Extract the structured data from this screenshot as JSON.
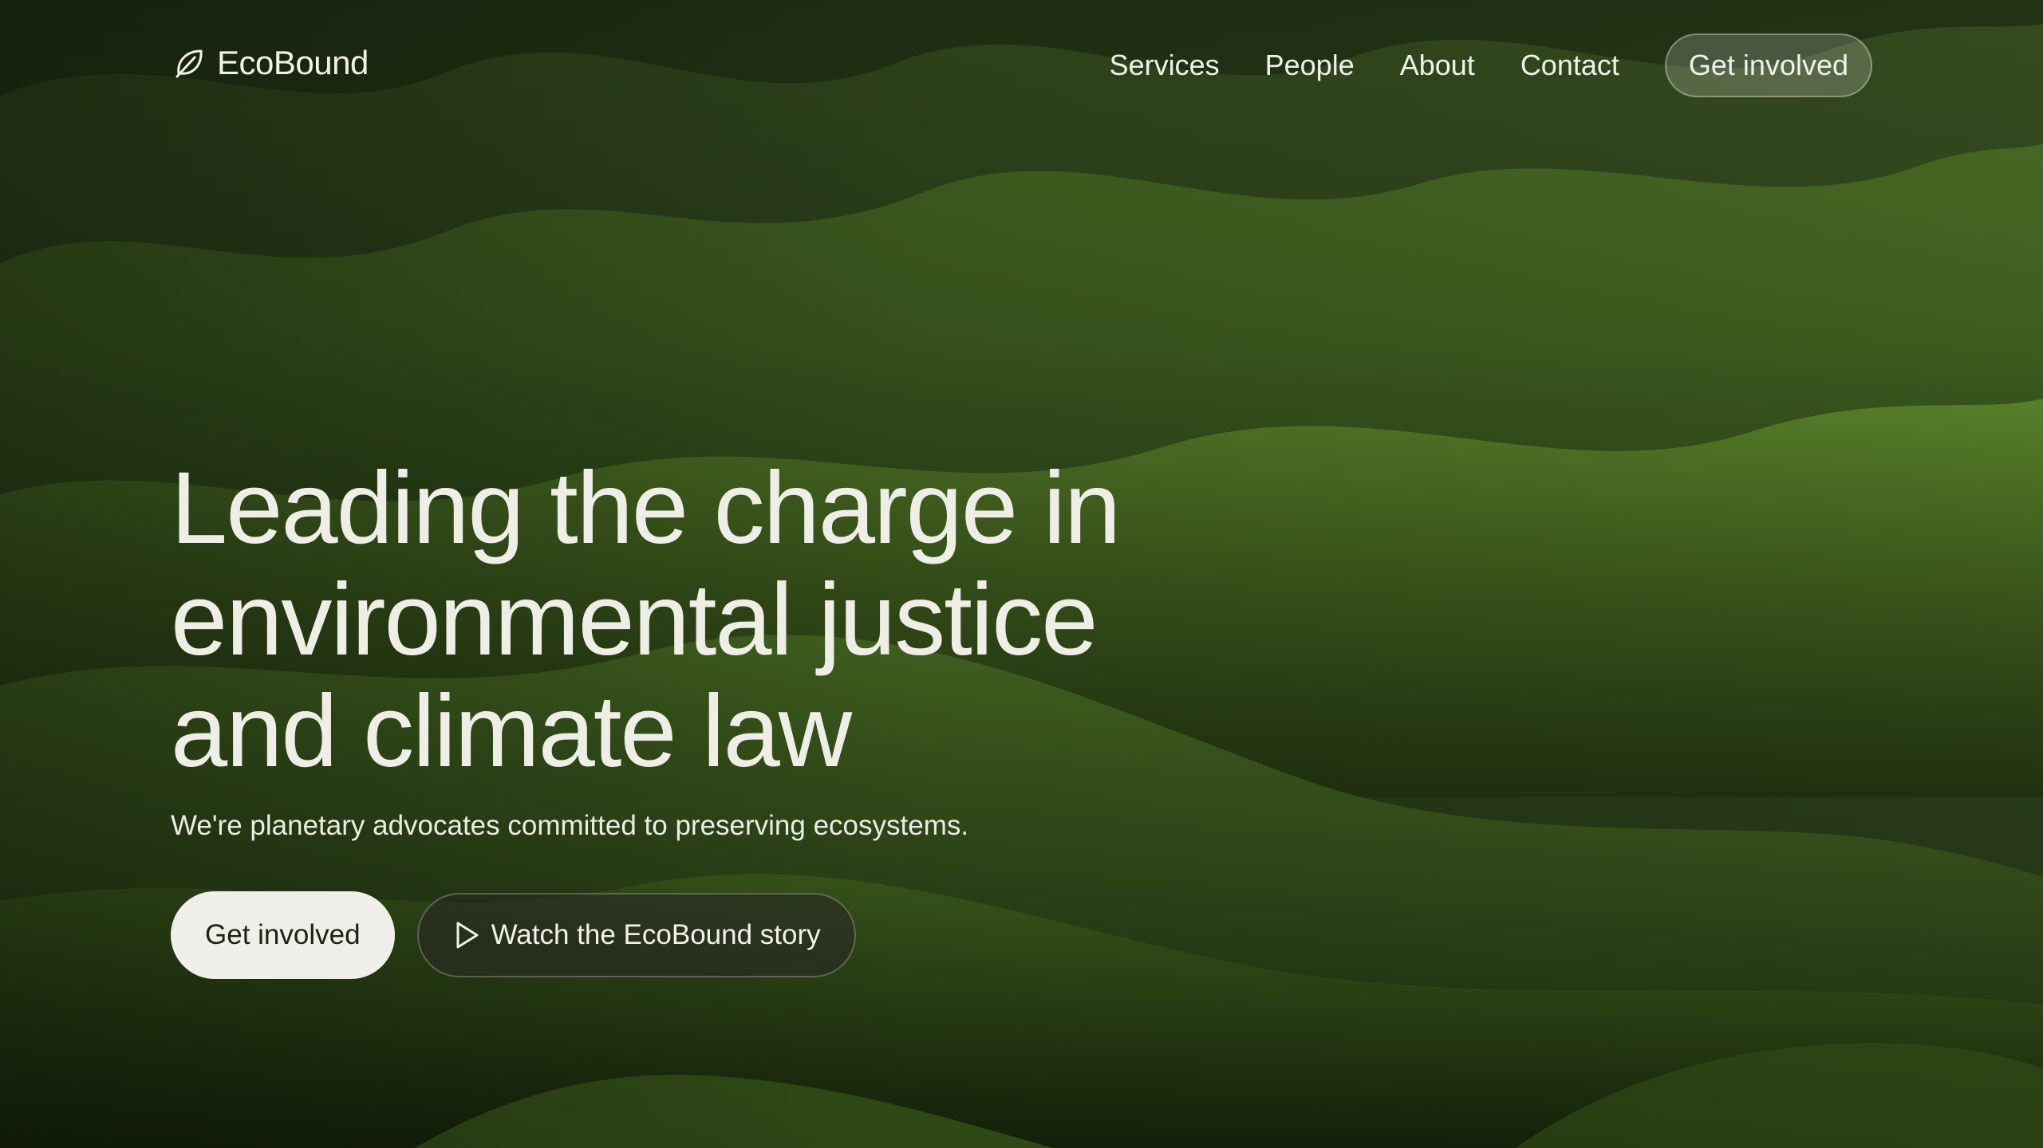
{
  "brand": {
    "name": "EcoBound",
    "icon": "leaf-icon"
  },
  "nav": {
    "links": [
      "Services",
      "People",
      "About",
      "Contact"
    ],
    "cta_label": "Get involved"
  },
  "hero": {
    "title": "Leading the charge in environmental justice and climate law",
    "subtitle": "We're planetary advocates committed to preserving ecosystems.",
    "primary_button": "Get involved",
    "secondary_button": "Watch the EcoBound story",
    "secondary_icon": "play-icon"
  },
  "colors": {
    "text": "#eeeee6",
    "primary_button_bg": "#efeee8",
    "primary_button_text": "#1d2117",
    "landscape_green": "#3d5a22"
  }
}
